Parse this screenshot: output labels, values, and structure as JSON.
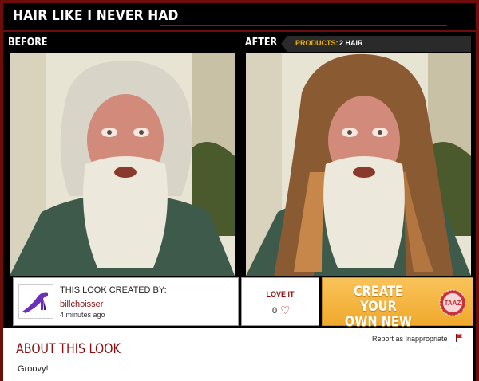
{
  "header": {
    "title": "HAIR LIKE I NEVER HAD"
  },
  "panels": {
    "before_label": "BEFORE",
    "after_label": "AFTER",
    "products_label": "PRODUCTS:",
    "products_value": "2 HAIR"
  },
  "creator": {
    "caption": "THIS LOOK CREATED BY:",
    "username": "billchoisser",
    "time": "4 minutes ago",
    "avatar_icon": "purple-high-heel-shoe"
  },
  "love": {
    "label": "LOVE IT",
    "count": "0",
    "icon": "heart-outline"
  },
  "create_cta": {
    "line1": "CREATE YOUR",
    "line2": "OWN NEW LOOK",
    "brand_badge": "TAAZ"
  },
  "about": {
    "title": "ABOUT THIS LOOK",
    "report_label": "Report as Inappropriate",
    "body": "Groovy!"
  },
  "colors": {
    "frame": "#6e0b0b",
    "accent_red": "#8b0d0d",
    "cta_orange": "#f0a92c",
    "products_label": "#f0b400"
  }
}
